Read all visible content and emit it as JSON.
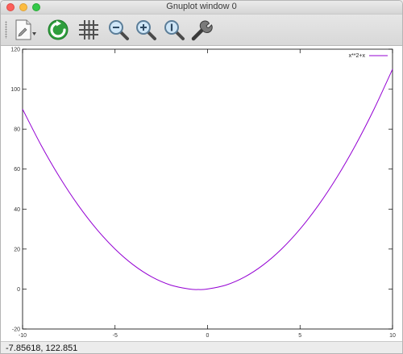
{
  "window": {
    "title": "Gnuplot window 0"
  },
  "toolbar": {
    "tools": [
      {
        "name": "export-button",
        "icon": "document-export-icon"
      },
      {
        "name": "replot-button",
        "icon": "refresh-icon"
      },
      {
        "name": "grid-button",
        "icon": "grid-icon"
      },
      {
        "name": "zoom-out-button",
        "icon": "zoom-out-icon"
      },
      {
        "name": "zoom-in-button",
        "icon": "zoom-in-icon"
      },
      {
        "name": "zoom-reset-button",
        "icon": "zoom-fit-icon"
      },
      {
        "name": "settings-button",
        "icon": "wrench-icon"
      }
    ]
  },
  "status": {
    "coords": "-7.85618,  122.851"
  },
  "colors": {
    "curve": "#9400d3"
  },
  "chart_data": {
    "type": "line",
    "title": "",
    "xlabel": "",
    "ylabel": "",
    "xlim": [
      -10,
      10
    ],
    "ylim": [
      -20,
      120
    ],
    "xticks": [
      -10,
      -5,
      0,
      5,
      10
    ],
    "yticks": [
      -20,
      0,
      20,
      40,
      60,
      80,
      100,
      120
    ],
    "legend_position": "top-right",
    "series": [
      {
        "name": "x**2+x",
        "x": [
          -10,
          -9,
          -8,
          -7,
          -6,
          -5,
          -4,
          -3,
          -2,
          -1,
          -0.5,
          0,
          1,
          2,
          3,
          4,
          5,
          6,
          7,
          8,
          9,
          10
        ],
        "y": [
          90,
          72,
          56,
          42,
          30,
          20,
          12,
          6,
          2,
          0,
          -0.25,
          0,
          2,
          6,
          12,
          20,
          30,
          42,
          56,
          72,
          90,
          110
        ]
      }
    ]
  }
}
